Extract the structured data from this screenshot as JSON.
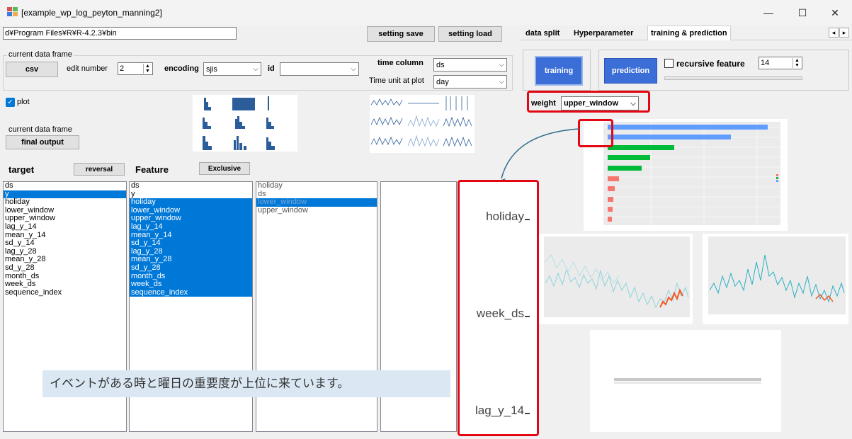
{
  "window": {
    "title": "[example_wp_log_peyton_manning2]"
  },
  "left": {
    "path_value": "d¥Program Files¥R¥R-4.2.3¥bin",
    "setting_save": "setting save",
    "setting_load": "setting load",
    "group_title": "current data frame",
    "csv": "csv",
    "edit_number_label": "edit number",
    "edit_number_value": "2",
    "encoding_label": "encoding",
    "encoding_value": "sjis",
    "id_label": "id",
    "id_value": "",
    "time_column_label": "time column",
    "time_column_value": "ds",
    "time_unit_label": "Time unit at plot",
    "time_unit_value": "day",
    "plot_label": "plot",
    "current_df_label": "current data frame",
    "final_output": "final output",
    "target_label": "target",
    "reversal": "reversal",
    "feature_label": "Feature",
    "exclusive": "Exclusive"
  },
  "target_list": [
    {
      "label": "ds",
      "selected": false
    },
    {
      "label": "y",
      "selected": true
    },
    {
      "label": "holiday",
      "selected": false
    },
    {
      "label": "lower_window",
      "selected": false
    },
    {
      "label": "upper_window",
      "selected": false
    },
    {
      "label": "lag_y_14",
      "selected": false
    },
    {
      "label": "mean_y_14",
      "selected": false
    },
    {
      "label": "sd_y_14",
      "selected": false
    },
    {
      "label": "lag_y_28",
      "selected": false
    },
    {
      "label": "mean_y_28",
      "selected": false
    },
    {
      "label": "sd_y_28",
      "selected": false
    },
    {
      "label": "month_ds",
      "selected": false
    },
    {
      "label": "week_ds",
      "selected": false
    },
    {
      "label": "sequence_index",
      "selected": false
    }
  ],
  "feature_list": [
    {
      "label": "ds",
      "selected": false
    },
    {
      "label": "y",
      "selected": false
    },
    {
      "label": "holiday",
      "selected": true
    },
    {
      "label": "lower_window",
      "selected": true
    },
    {
      "label": "upper_window",
      "selected": true
    },
    {
      "label": "lag_y_14",
      "selected": true
    },
    {
      "label": "mean_y_14",
      "selected": true
    },
    {
      "label": "sd_y_14",
      "selected": true
    },
    {
      "label": "lag_y_28",
      "selected": true
    },
    {
      "label": "mean_y_28",
      "selected": true
    },
    {
      "label": "sd_y_28",
      "selected": true
    },
    {
      "label": "month_ds",
      "selected": true
    },
    {
      "label": "week_ds",
      "selected": true
    },
    {
      "label": "sequence_index",
      "selected": true
    }
  ],
  "exclusive_list": [
    {
      "label": "holiday",
      "selected": false
    },
    {
      "label": "ds",
      "selected": false
    },
    {
      "label": "lower_window",
      "selected": true
    },
    {
      "label": "upper_window",
      "selected": false
    }
  ],
  "tabs": [
    {
      "label": "data split",
      "active": false
    },
    {
      "label": "Hyperparameter",
      "active": false
    },
    {
      "label": "training & prediction",
      "active": true
    }
  ],
  "tab_scroll_left": "◂",
  "tab_scroll_right": "▸",
  "right": {
    "training": "training",
    "prediction": "prediction",
    "recursive_label": "recursive feature",
    "recursive_value": "14",
    "weight_label": "weight",
    "weight_value": "upper_window"
  },
  "zoom_labels": [
    "holiday",
    "week_ds",
    "lag_y_14"
  ],
  "caption": "イベントがある時と曜日の重要度が上位に来ています。",
  "colors": {
    "accent": "#0078d7",
    "highlight": "#e30613",
    "button_blue": "#3c6ed8"
  }
}
